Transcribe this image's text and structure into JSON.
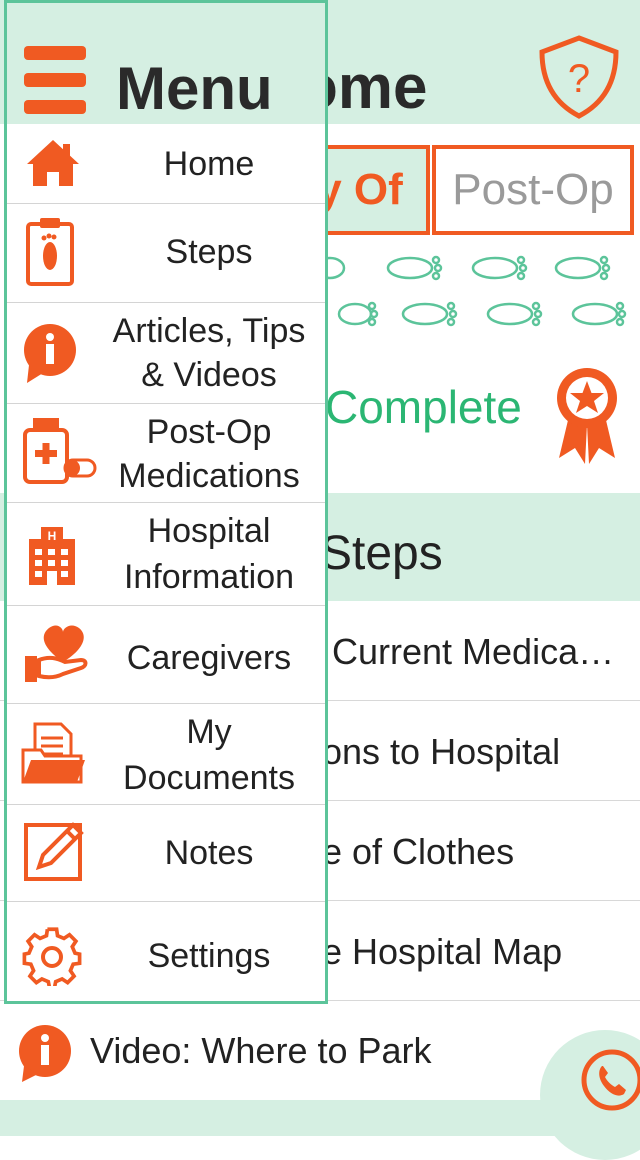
{
  "colors": {
    "accent": "#f05a22",
    "mint": "#d5efe2",
    "green": "#2bb673",
    "border": "#5cc49a"
  },
  "home": {
    "title": "ome",
    "tabs": [
      {
        "label": "y Of",
        "active": true
      },
      {
        "label": "Post-Op",
        "active": false
      }
    ],
    "complete_label": "Complete",
    "steps_title": "Steps",
    "steps": [
      {
        "label": "Current Medica…"
      },
      {
        "label": "ons to Hospital"
      },
      {
        "label": "e of Clothes"
      },
      {
        "label": "e Hospital Map"
      }
    ],
    "video_label": "Video: Where to Park"
  },
  "menu": {
    "title": "Menu",
    "items": [
      {
        "line1": "Home",
        "line2": "",
        "icon": "home-icon"
      },
      {
        "line1": "Steps",
        "line2": "",
        "icon": "steps-clipboard-icon"
      },
      {
        "line1": "Articles, Tips",
        "line2": "& Videos",
        "icon": "info-icon"
      },
      {
        "line1": "Post-Op",
        "line2": "Medications",
        "icon": "medication-icon"
      },
      {
        "line1": "Hospital",
        "line2": "Information",
        "icon": "hospital-icon"
      },
      {
        "line1": "Caregivers",
        "line2": "",
        "icon": "caregivers-icon"
      },
      {
        "line1": "My",
        "line2": "Documents",
        "icon": "documents-icon"
      },
      {
        "line1": "Notes",
        "line2": "",
        "icon": "notes-icon"
      },
      {
        "line1": "Settings",
        "line2": "",
        "icon": "gear-icon"
      }
    ]
  }
}
